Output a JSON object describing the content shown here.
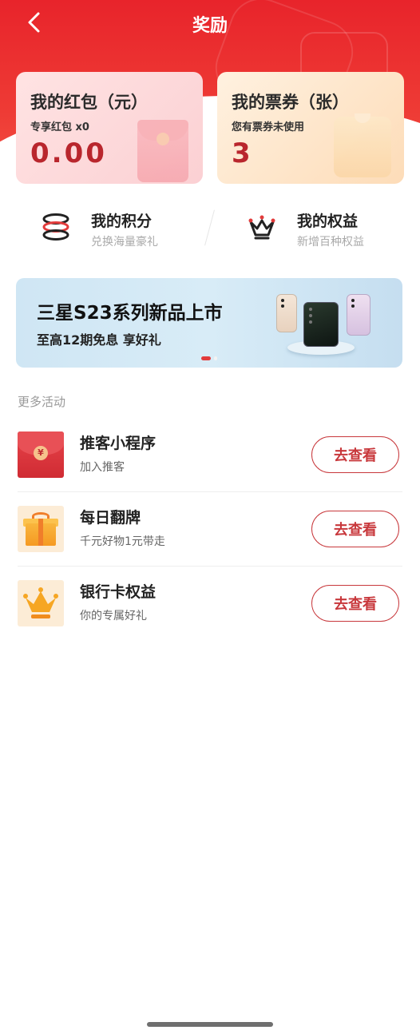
{
  "header": {
    "title": "奖励"
  },
  "cards": {
    "red_packet": {
      "title": "我的红包（元）",
      "subtitle": "专享红包 x0",
      "value": "0.00"
    },
    "tickets": {
      "title": "我的票券（张）",
      "subtitle": "您有票券未使用",
      "value": "3"
    }
  },
  "quick_links": {
    "points": {
      "title": "我的积分",
      "subtitle": "兑换海量豪礼",
      "icon": "coin-stack-icon"
    },
    "benefits": {
      "title": "我的权益",
      "subtitle": "新增百种权益",
      "icon": "crown-icon"
    }
  },
  "banner": {
    "title": "三星S23系列新品上市",
    "subtitle": "至高12期免息 享好礼",
    "dots_total": 2,
    "active_dot": 1
  },
  "more_activities": {
    "label": "更多活动",
    "items": [
      {
        "title": "推客小程序",
        "subtitle": "加入推客",
        "button": "去查看",
        "icon": "red-envelope-icon"
      },
      {
        "title": "每日翻牌",
        "subtitle": "千元好物1元带走",
        "button": "去查看",
        "icon": "gift-box-icon"
      },
      {
        "title": "银行卡权益",
        "subtitle": "你的专属好礼",
        "button": "去查看",
        "icon": "crown-icon"
      }
    ]
  },
  "colors": {
    "brand_red": "#e8242b",
    "accent_red": "#c8383c",
    "value_red": "#b9262d"
  }
}
